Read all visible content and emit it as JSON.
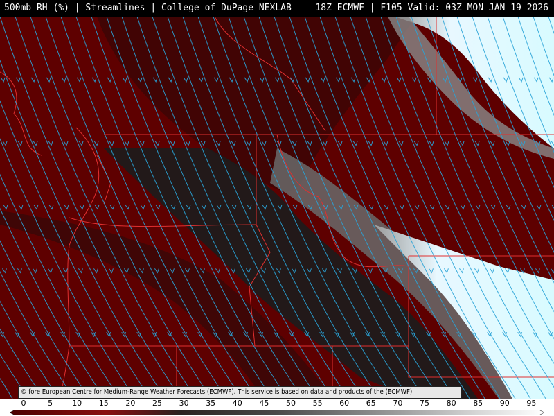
{
  "header": {
    "left": "500mb RH (%) | Streamlines | College of DuPage NEXLAB",
    "right": "18Z ECMWF | F105 Valid: 03Z MON JAN 19 2026"
  },
  "credit": "© fore European Centre for Medium-Range Weather Forecasts (ECMWF). This service is based on data and products of the (ECMWF)",
  "legend": {
    "ticks": [
      "0",
      "5",
      "10",
      "15",
      "20",
      "25",
      "30",
      "35",
      "40",
      "45",
      "50",
      "55",
      "60",
      "65",
      "70",
      "75",
      "80",
      "85",
      "90",
      "95"
    ],
    "colors": {
      "dry": "#5e0000",
      "mid": "#1a1a1a",
      "moist": "#d8fbff",
      "streamline": "#2aa4d8",
      "border": "#e03030"
    }
  },
  "map": {
    "variable": "500mb RH",
    "overlay": "Streamlines",
    "model": "ECMWF",
    "init": "18Z",
    "forecast_hour": "F105"
  }
}
